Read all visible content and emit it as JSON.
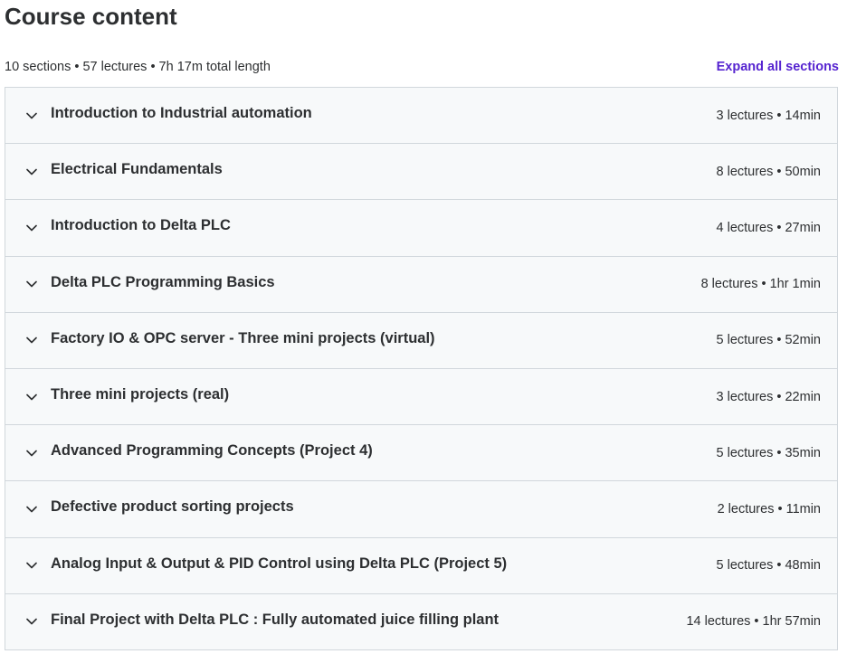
{
  "page": {
    "title": "Course content"
  },
  "summary": {
    "text": "10 sections • 57 lectures • 7h 17m total length",
    "expand_label": "Expand all sections"
  },
  "colors": {
    "link": "#5624d0",
    "section_bg": "#f7f9fa",
    "border": "#d1d7dc",
    "text": "#2d2f31"
  },
  "sections": [
    {
      "icon": "chevron-down-icon",
      "title": "Introduction to Industrial automation",
      "meta": "3 lectures • 14min"
    },
    {
      "icon": "chevron-down-icon",
      "title": "Electrical Fundamentals",
      "meta": "8 lectures • 50min"
    },
    {
      "icon": "chevron-down-icon",
      "title": "Introduction to Delta PLC",
      "meta": "4 lectures • 27min"
    },
    {
      "icon": "chevron-down-icon",
      "title": "Delta PLC Programming Basics",
      "meta": "8 lectures • 1hr 1min"
    },
    {
      "icon": "chevron-down-icon",
      "title": "Factory IO & OPC server - Three mini projects (virtual)",
      "meta": "5 lectures • 52min"
    },
    {
      "icon": "chevron-down-icon",
      "title": "Three mini projects (real)",
      "meta": "3 lectures • 22min"
    },
    {
      "icon": "chevron-down-icon",
      "title": "Advanced Programming Concepts (Project 4)",
      "meta": "5 lectures • 35min"
    },
    {
      "icon": "chevron-down-icon",
      "title": "Defective product sorting projects",
      "meta": "2 lectures • 11min"
    },
    {
      "icon": "chevron-down-icon",
      "title": "Analog Input & Output & PID Control using Delta PLC (Project 5)",
      "meta": "5 lectures • 48min"
    },
    {
      "icon": "chevron-down-icon",
      "title": "Final Project with Delta PLC : Fully automated juice filling plant",
      "meta": "14 lectures • 1hr 57min"
    }
  ]
}
